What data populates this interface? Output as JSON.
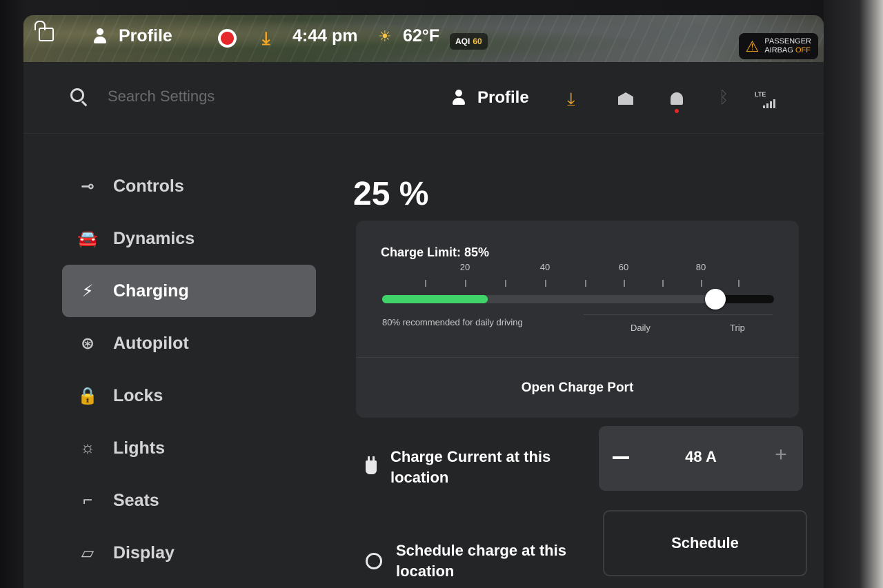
{
  "statusbar": {
    "profile_label": "Profile",
    "time": "4:44 pm",
    "temperature": "62°F",
    "aqi_label": "AQI",
    "aqi_value": "60",
    "airbag_line1": "PASSENGER",
    "airbag_line2": "AIRBAG",
    "airbag_state": "OFF"
  },
  "header": {
    "search_placeholder": "Search Settings",
    "profile_label": "Profile",
    "lte_label": "LTE"
  },
  "sidebar": {
    "items": [
      {
        "label": "Controls",
        "icon": "toggle-icon"
      },
      {
        "label": "Dynamics",
        "icon": "car-icon"
      },
      {
        "label": "Charging",
        "icon": "lightning-icon",
        "active": true
      },
      {
        "label": "Autopilot",
        "icon": "steering-wheel-icon"
      },
      {
        "label": "Locks",
        "icon": "lock-icon"
      },
      {
        "label": "Lights",
        "icon": "light-icon"
      },
      {
        "label": "Seats",
        "icon": "seat-icon"
      },
      {
        "label": "Display",
        "icon": "display-icon"
      }
    ]
  },
  "charging": {
    "battery_percent": "25 %",
    "charge_limit_label": "Charge Limit: 85%",
    "battery_level": 25,
    "charge_limit": 85,
    "tick_labels": [
      "20",
      "40",
      "60",
      "80"
    ],
    "recommendation": "80% recommended for daily driving",
    "zone_daily": "Daily",
    "zone_trip": "Trip",
    "open_port_label": "Open Charge Port",
    "charge_current_label": "Charge Current at this location",
    "charge_current_value": "48 A",
    "schedule_label": "Schedule charge at this location",
    "schedule_button": "Schedule"
  },
  "colors": {
    "accent_green": "#3fd36a",
    "warning_orange": "#f5a623",
    "record_red": "#e5262a",
    "active_nav": "#5b5c60"
  }
}
